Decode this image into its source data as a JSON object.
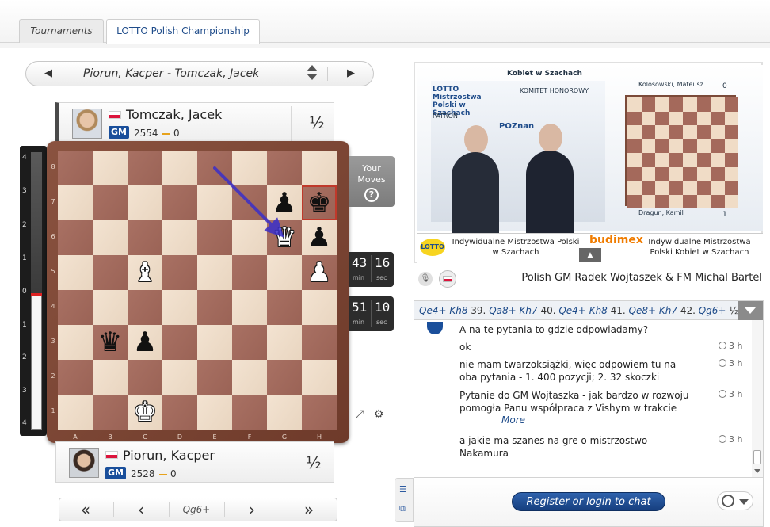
{
  "tabs": [
    {
      "label": "Tournaments"
    },
    {
      "label": "LOTTO Polish Championship"
    }
  ],
  "game_selector": {
    "prev_icon": "triangle-left",
    "next_icon": "triangle-right",
    "title": "Piorun, Kacper - Tomczak, Jacek"
  },
  "players": {
    "top": {
      "name": "Tomczak, Jacek",
      "title": "GM",
      "rating": "2554",
      "points": "0",
      "score": "½",
      "flag": "poland"
    },
    "bottom": {
      "name": "Piorun, Kacper",
      "title": "GM",
      "rating": "2528",
      "points": "0",
      "score": "½",
      "flag": "poland"
    }
  },
  "eval_bar": {
    "labels": [
      "4",
      "3",
      "2",
      "1",
      "0",
      "1",
      "2",
      "3",
      "4"
    ],
    "evaluation": 0.0
  },
  "board": {
    "ranks": [
      "8",
      "7",
      "6",
      "5",
      "4",
      "3",
      "2",
      "1"
    ],
    "files": [
      "A",
      "B",
      "C",
      "D",
      "E",
      "F",
      "G",
      "H"
    ],
    "pieces": [
      {
        "square": "g7",
        "piece": "bp"
      },
      {
        "square": "h7",
        "piece": "bk"
      },
      {
        "square": "g6",
        "piece": "wq"
      },
      {
        "square": "h6",
        "piece": "bp"
      },
      {
        "square": "c5",
        "piece": "wb"
      },
      {
        "square": "h5",
        "piece": "wp"
      },
      {
        "square": "b3",
        "piece": "bq"
      },
      {
        "square": "c3",
        "piece": "bp"
      },
      {
        "square": "c1",
        "piece": "wk"
      }
    ],
    "highlight": "h7",
    "arrow": {
      "from": "e8",
      "to": "g6",
      "color": "#3b2fc9"
    }
  },
  "your_moves": {
    "line1": "Your",
    "line2": "Moves",
    "icon": "question-circle-icon"
  },
  "clocks": {
    "top": {
      "min": "43",
      "sec": "16",
      "min_label": "min",
      "sec_label": "sec"
    },
    "bottom": {
      "min": "51",
      "sec": "10",
      "min_label": "min",
      "sec_label": "sec"
    }
  },
  "tools": {
    "flip_icon": "board-flip-icon",
    "settings_icon": "gear-icon"
  },
  "move_nav": {
    "first": "«",
    "prev": "‹",
    "current": "Qg6+",
    "next": "›",
    "last": "»"
  },
  "video": {
    "banner_top": "Kobiet w Szachach",
    "banner_left": "LOTTO Mistrzostwa Polski w Szachach",
    "sponsors": [
      "PATRON",
      "POZnan",
      "KOMITET HONOROWY"
    ],
    "mini_top_player": "Kolosowski, Mateusz",
    "mini_bottom_player": "Dragun, Kamil",
    "mini_top_score": "0",
    "mini_bottom_score": "1",
    "logo": "LOTTO",
    "title_left": "Indywidualne Mistrzostwa Polski w Szachach",
    "sponsor2": "budimex",
    "title_right": "Indywidualne Mistrzostwa Polski Kobiet w Szachach",
    "toggle": "▲"
  },
  "commentary": {
    "mic_icon": "microphone-icon",
    "flag_icon": "poland-flag-icon",
    "text": "Polish GM Radek Wojtaszek & FM Michal Bartel"
  },
  "moves_bar": {
    "items": [
      {
        "t": "Qe4+",
        "k": "m"
      },
      {
        "t": " ",
        "k": "t"
      },
      {
        "t": "Kh8",
        "k": "m"
      },
      {
        "t": " 39. ",
        "k": "t"
      },
      {
        "t": "Qa8+",
        "k": "m"
      },
      {
        "t": " ",
        "k": "t"
      },
      {
        "t": "Kh7",
        "k": "m"
      },
      {
        "t": " 40. ",
        "k": "t"
      },
      {
        "t": "Qe4+",
        "k": "m"
      },
      {
        "t": " ",
        "k": "t"
      },
      {
        "t": "Kh8",
        "k": "m"
      },
      {
        "t": " 41. ",
        "k": "t"
      },
      {
        "t": "Qe8+",
        "k": "m"
      },
      {
        "t": " ",
        "k": "t"
      },
      {
        "t": "Kh7",
        "k": "m"
      },
      {
        "t": " 42. ",
        "k": "t"
      },
      {
        "t": "Qg6+",
        "k": "m"
      },
      {
        "t": " ½-½",
        "k": "t"
      }
    ]
  },
  "chat": {
    "messages": [
      {
        "text": "A na te pytania to gdzie odpowiadamy?",
        "time": ""
      },
      {
        "text": "ok",
        "time": "3 h"
      },
      {
        "text": "nie mam twarzoksiążki, więc odpowiem tu na oba pytania - 1. 400 pozycji; 2. 32 skoczki",
        "time": "3 h"
      },
      {
        "text": "Pytanie do GM Wojtaszka - jak bardzo w rozwoju pomogła Panu współpraca z Vishym w trakcie",
        "time": "3 h",
        "more": "More"
      },
      {
        "text": "a jakie ma szanes na gre o mistrzostwo Nakamura",
        "time": "3 h"
      }
    ],
    "login_label": "Register or login to chat",
    "globe_icon": "globe-icon",
    "side_icons": [
      "list-icon",
      "link-icon"
    ]
  },
  "colors": {
    "accent": "#1a4f9b",
    "light_square": "#f0dcc6",
    "dark_square": "#a4695b",
    "board_frame": "#7b4a39",
    "highlight": "#c0392b"
  }
}
